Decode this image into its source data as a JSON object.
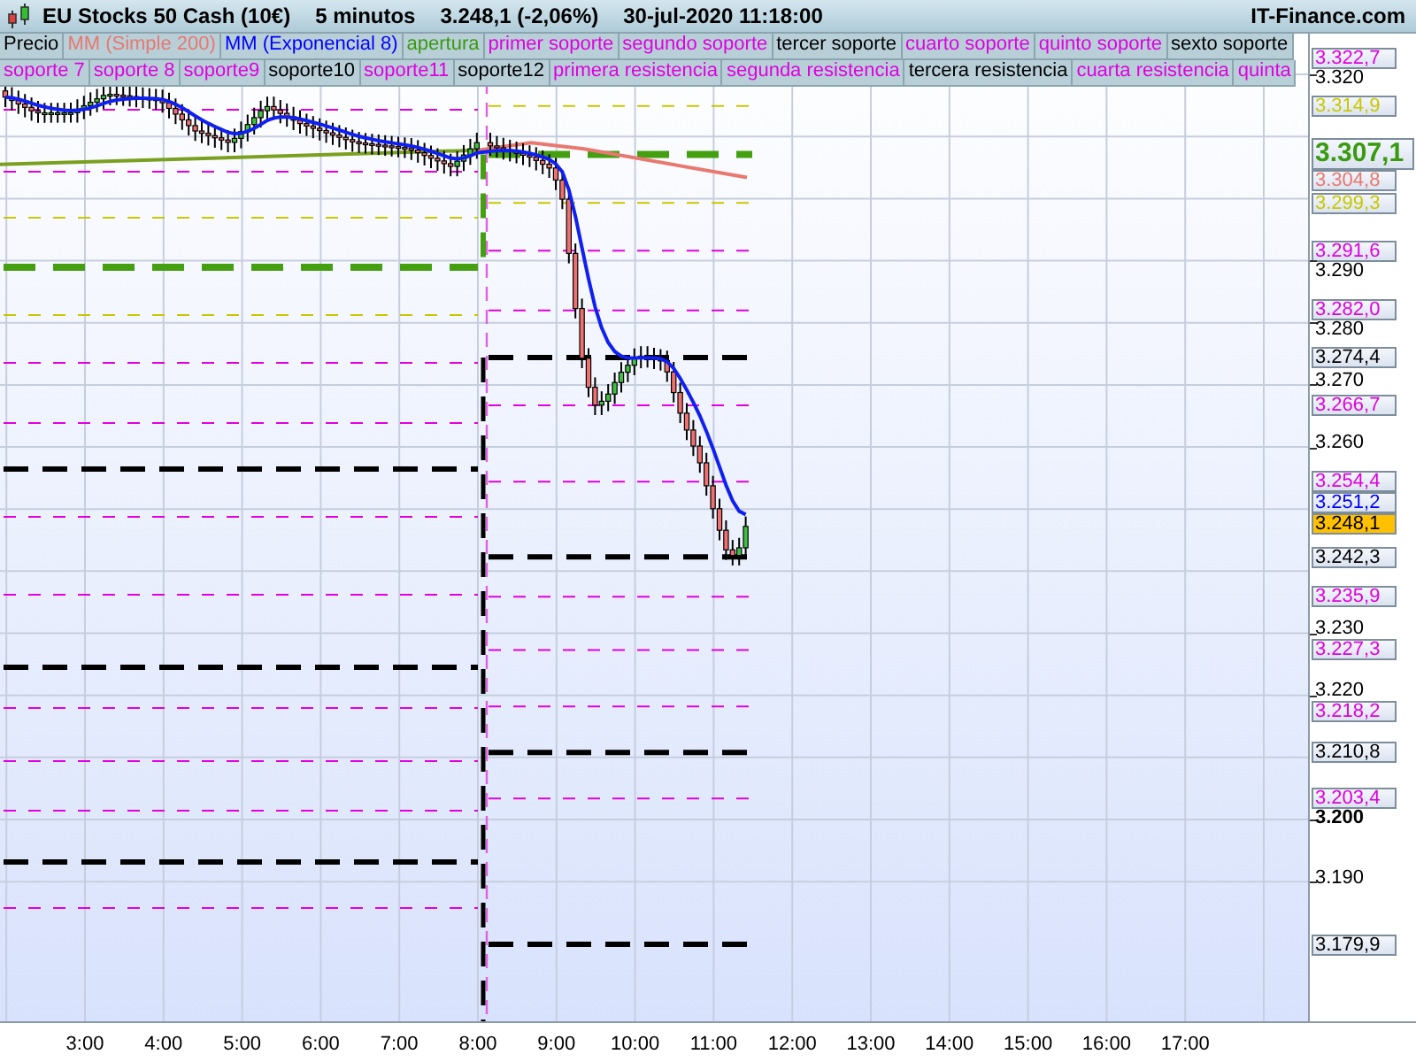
{
  "header": {
    "title": "EU Stocks 50 Cash (10€)",
    "interval": "5 minutos",
    "quote": "3.248,1 (-2,06%)",
    "datetime": "30-jul-2020 11:18:00",
    "site": "IT-Finance.com"
  },
  "legend_top": [
    {
      "label": "Precio",
      "color": "#000000"
    },
    {
      "label": "MM (Simple 200)",
      "color": "#e87870"
    },
    {
      "label": "MM (Exponencial 8)",
      "color": "#0000ff"
    },
    {
      "label": "apertura",
      "color": "#3a9a10"
    },
    {
      "label": "primer soporte",
      "color": "#e000e0"
    },
    {
      "label": "segundo soporte",
      "color": "#e000e0"
    },
    {
      "label": "tercer soporte",
      "color": "#000000"
    },
    {
      "label": "cuarto soporte",
      "color": "#e000e0"
    },
    {
      "label": "quinto soporte",
      "color": "#e000e0"
    },
    {
      "label": "sexto soporte",
      "color": "#000000"
    }
  ],
  "legend_bottom": [
    {
      "label": "soporte 7",
      "color": "#e000e0"
    },
    {
      "label": "soporte 8",
      "color": "#e000e0"
    },
    {
      "label": "soporte9",
      "color": "#e000e0"
    },
    {
      "label": "soporte10",
      "color": "#000000"
    },
    {
      "label": "soporte11",
      "color": "#e000e0"
    },
    {
      "label": "soporte12",
      "color": "#000000"
    },
    {
      "label": "primera resistencia",
      "color": "#e000e0"
    },
    {
      "label": "segunda resistencia",
      "color": "#e000e0"
    },
    {
      "label": "tercera resistencia",
      "color": "#000000"
    },
    {
      "label": "cuarta resistencia",
      "color": "#e000e0"
    },
    {
      "label": "quinta",
      "color": "#e000e0"
    }
  ],
  "price_axis": {
    "ticks": [
      {
        "label": "3.320",
        "bold": false
      },
      {
        "label": "3.290",
        "bold": false
      },
      {
        "label": "3.280",
        "bold": false
      },
      {
        "label": "3.270",
        "bold": false
      },
      {
        "label": "3.260",
        "bold": false
      },
      {
        "label": "3.230",
        "bold": false
      },
      {
        "label": "3.220",
        "bold": false
      },
      {
        "label": "3.200",
        "bold": true
      },
      {
        "label": "3.190",
        "bold": false
      }
    ]
  },
  "price_tags": [
    {
      "label": "3.322,7",
      "color": "#e000e0",
      "kind": "level"
    },
    {
      "label": "3.314,9",
      "color": "#c8c800",
      "kind": "level"
    },
    {
      "label": "3.307,1",
      "color": "#3a9a10",
      "kind": "open"
    },
    {
      "label": "3.304,8",
      "color": "#e87870",
      "kind": "level"
    },
    {
      "label": "3.299,3",
      "color": "#c8c800",
      "kind": "level"
    },
    {
      "label": "3.291,6",
      "color": "#e000e0",
      "kind": "level"
    },
    {
      "label": "3.282,0",
      "color": "#e000e0",
      "kind": "level"
    },
    {
      "label": "3.274,4",
      "color": "#000000",
      "kind": "level"
    },
    {
      "label": "3.266,7",
      "color": "#e000e0",
      "kind": "level"
    },
    {
      "label": "3.254,4",
      "color": "#e000e0",
      "kind": "level"
    },
    {
      "label": "3.251,2",
      "color": "#0000ff",
      "kind": "level"
    },
    {
      "label": "3.248,1",
      "kind": "last"
    },
    {
      "label": "3.242,3",
      "color": "#000000",
      "kind": "level"
    },
    {
      "label": "3.235,9",
      "color": "#e000e0",
      "kind": "level"
    },
    {
      "label": "3.227,3",
      "color": "#e000e0",
      "kind": "level"
    },
    {
      "label": "3.218,2",
      "color": "#e000e0",
      "kind": "level"
    },
    {
      "label": "3.210,8",
      "color": "#000000",
      "kind": "level"
    },
    {
      "label": "3.203,4",
      "color": "#e000e0",
      "kind": "level"
    },
    {
      "label": "3.179,9",
      "color": "#000000",
      "kind": "level"
    }
  ],
  "time_axis": {
    "labels": [
      "3:00",
      "4:00",
      "5:00",
      "6:00",
      "7:00",
      "8:00",
      "9:00",
      "10:00",
      "11:00",
      "12:00",
      "13:00",
      "14:00",
      "15:00",
      "16:00",
      "17:00"
    ]
  }
}
